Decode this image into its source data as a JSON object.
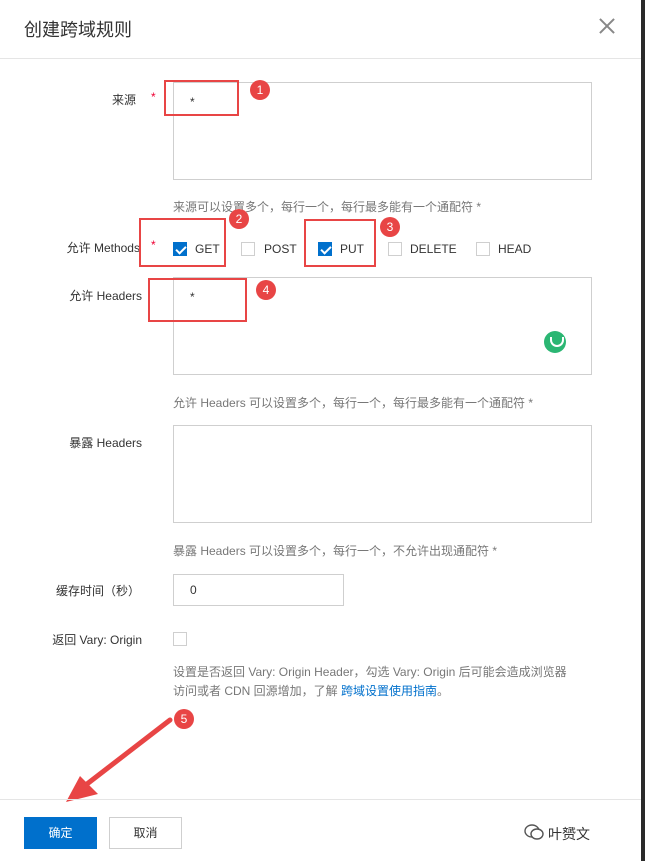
{
  "dialog": {
    "title": "创建跨域规则"
  },
  "origin": {
    "label": "来源",
    "required_mark": "*",
    "value": "*",
    "hint": "来源可以设置多个，每行一个，每行最多能有一个通配符 *"
  },
  "methods": {
    "label": "允许 Methods",
    "required_mark": "*",
    "options": [
      {
        "label": "GET",
        "checked": true
      },
      {
        "label": "POST",
        "checked": false
      },
      {
        "label": "PUT",
        "checked": true
      },
      {
        "label": "DELETE",
        "checked": false
      },
      {
        "label": "HEAD",
        "checked": false
      }
    ]
  },
  "allow_headers": {
    "label": "允许 Headers",
    "value": "*",
    "hint": "允许 Headers 可以设置多个，每行一个，每行最多能有一个通配符 *"
  },
  "expose_headers": {
    "label": "暴露 Headers",
    "hint": "暴露 Headers 可以设置多个，每行一个，不允许出现通配符 *"
  },
  "cache_time": {
    "label": "缓存时间（秒）",
    "value": "0"
  },
  "vary_origin": {
    "label": "返回 Vary: Origin",
    "checked": false,
    "hint_line1": "设置是否返回 Vary: Origin Header，勾选 Vary: Origin 后可能会造成浏览器",
    "hint_line2_prefix": "访问或者 CDN 回源增加，了解 ",
    "hint_link": "跨域设置使用指南",
    "hint_line2_suffix": "。"
  },
  "annotations": {
    "markers": [
      "1",
      "2",
      "3",
      "4",
      "5"
    ],
    "color": "#e84545"
  },
  "footer": {
    "confirm_label": "确定",
    "cancel_label": "取消"
  },
  "watermark": {
    "text": "叶赟文"
  },
  "colors": {
    "primary": "#0070cc",
    "required": "#ee0033",
    "accent_green": "#2bb673"
  }
}
